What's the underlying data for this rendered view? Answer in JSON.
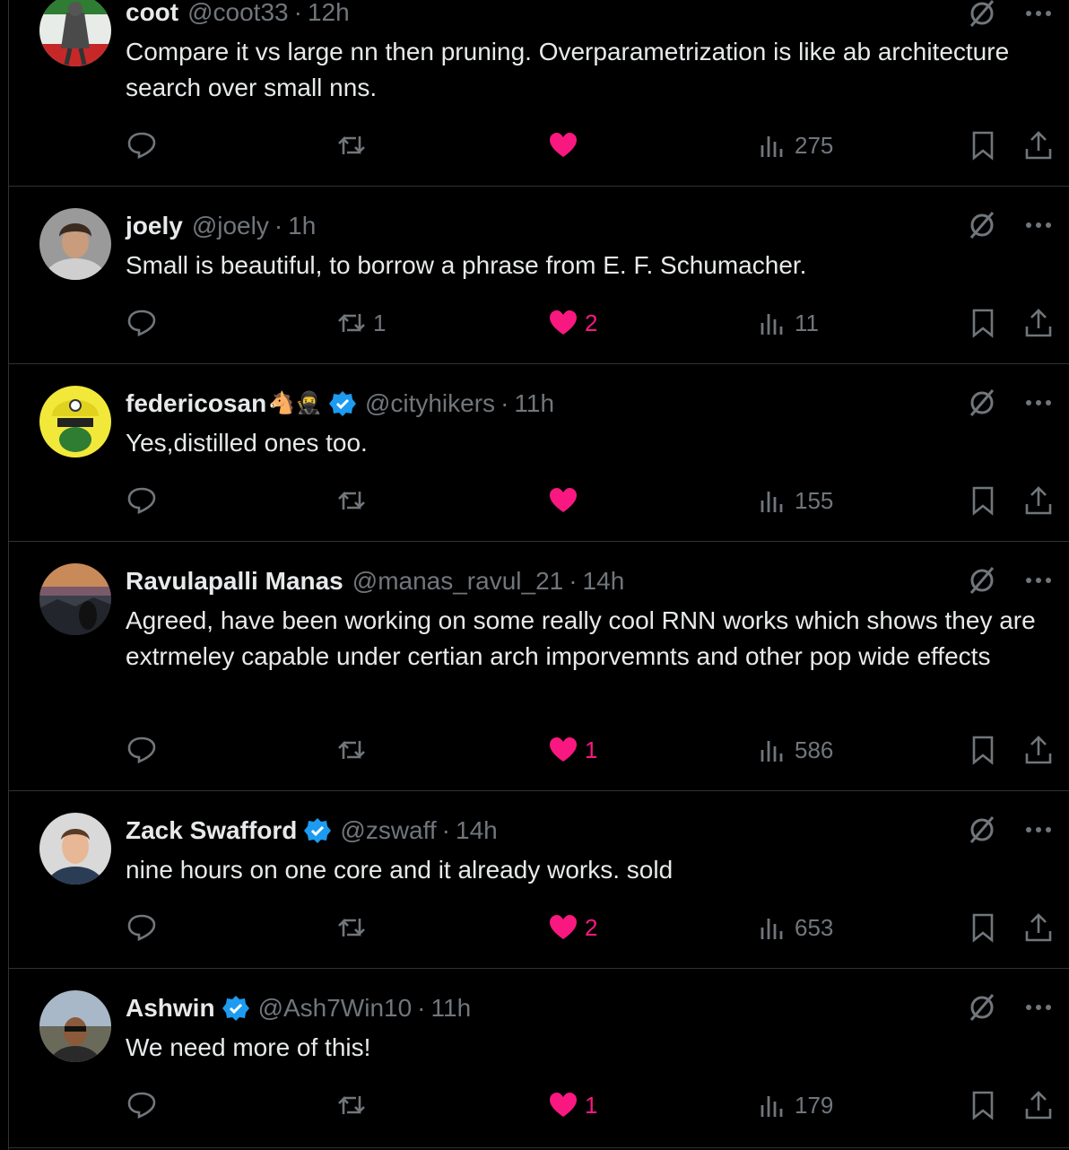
{
  "colors": {
    "background": "#000000",
    "text": "#e7e9ea",
    "muted": "#71767b",
    "like": "#f91880",
    "verified": "#1d9bf0",
    "divider": "#2f3336"
  },
  "icons": {
    "reply": "reply-icon",
    "repost": "repost-icon",
    "like": "heart-icon",
    "views": "views-icon",
    "bookmark": "bookmark-icon",
    "share": "share-icon",
    "grok": "grok-icon",
    "more": "more-icon"
  },
  "replies": [
    {
      "name": "coot",
      "emoji": "",
      "verified": false,
      "handle": "@coot33",
      "sep": "·",
      "time": "12h",
      "text": "Compare it vs large nn then pruning. Overparametrization is like ab architecture search over small nns.",
      "reply_count": "",
      "repost_count": "",
      "like_count": "",
      "liked": true,
      "views": "275"
    },
    {
      "name": "joely",
      "emoji": "",
      "verified": false,
      "handle": "@joely",
      "sep": "·",
      "time": "1h",
      "text": "Small is beautiful, to borrow a phrase from E. F. Schumacher.",
      "reply_count": "",
      "repost_count": "1",
      "like_count": "2",
      "liked": true,
      "views": "11"
    },
    {
      "name": "federicosan",
      "emoji": "🐴🥷",
      "verified": true,
      "handle": "@cityhikers",
      "sep": "·",
      "time": "11h",
      "text": "Yes,distilled ones too.",
      "reply_count": "",
      "repost_count": "",
      "like_count": "",
      "liked": true,
      "views": "155"
    },
    {
      "name": "Ravulapalli Manas",
      "emoji": "",
      "verified": false,
      "handle": "@manas_ravul_21",
      "sep": "·",
      "time": "14h",
      "text": "Agreed, have been working on some really cool RNN works which shows they are extrmeley capable under certian arch imporvemnts and other pop wide effects",
      "reply_count": "",
      "repost_count": "",
      "like_count": "1",
      "liked": true,
      "views": "586"
    },
    {
      "name": "Zack Swafford",
      "emoji": "",
      "verified": true,
      "handle": "@zswaff",
      "sep": "·",
      "time": "14h",
      "text": "nine hours on one core and it already works. sold",
      "reply_count": "",
      "repost_count": "",
      "like_count": "2",
      "liked": true,
      "views": "653"
    },
    {
      "name": "Ashwin",
      "emoji": "",
      "verified": true,
      "handle": "@Ash7Win10",
      "sep": "·",
      "time": "11h",
      "text": "We need more of this!",
      "reply_count": "",
      "repost_count": "",
      "like_count": "1",
      "liked": true,
      "views": "179"
    }
  ]
}
